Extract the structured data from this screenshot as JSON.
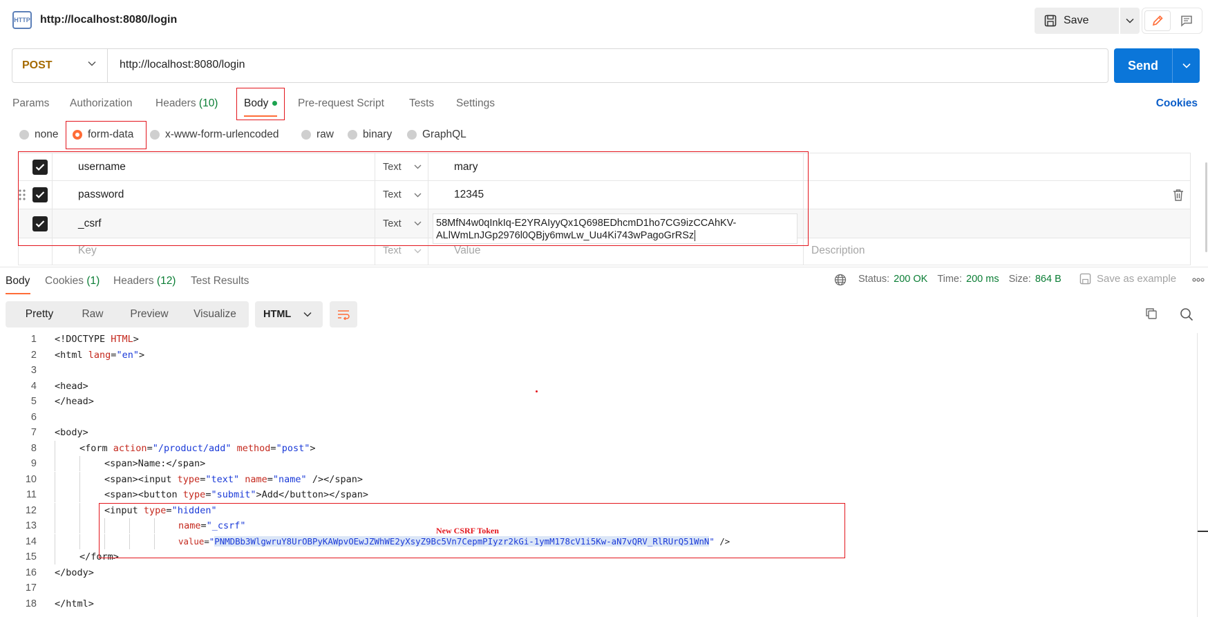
{
  "header": {
    "icon_label": "HTTP",
    "tab_title": "http://localhost:8080/login",
    "save_label": "Save"
  },
  "request": {
    "method": "POST",
    "url": "http://localhost:8080/login",
    "send_label": "Send"
  },
  "request_tabs": [
    {
      "label": "Params",
      "count": ""
    },
    {
      "label": "Authorization",
      "count": ""
    },
    {
      "label": "Headers",
      "count": "(10)"
    },
    {
      "label": "Body",
      "count": ""
    },
    {
      "label": "Pre-request Script",
      "count": ""
    },
    {
      "label": "Tests",
      "count": ""
    },
    {
      "label": "Settings",
      "count": ""
    }
  ],
  "cookies_link": "Cookies",
  "body_types": [
    "none",
    "form-data",
    "x-www-form-urlencoded",
    "raw",
    "binary",
    "GraphQL"
  ],
  "selected_body_type": "form-data",
  "form_rows": [
    {
      "key": "username",
      "type": "Text",
      "value": "mary",
      "checked": true
    },
    {
      "key": "password",
      "type": "Text",
      "value": "12345",
      "checked": true
    },
    {
      "key": "_csrf",
      "type": "Text",
      "value": "58MfN4w0qInkIq-E2YRAIyyQx1Q698EDhcmD1ho7CG9izCCAhKV-ALlWmLnJGp2976l0QBjy6mwLw_Uu4Ki743wPagoGrRSz",
      "value_line1": "58MfN4w0qInkIq-E2YRAIyyQx1Q698EDhcmD1ho7CG9izCCAhKV-",
      "value_line2": "ALlWmLnJGp2976l0QBjy6mwLw_Uu4Ki743wPagoGrRSz",
      "checked": true
    }
  ],
  "form_placeholders": {
    "key": "Key",
    "type": "Text",
    "value": "Value",
    "description": "Description"
  },
  "response_tabs": [
    {
      "label": "Body",
      "count": ""
    },
    {
      "label": "Cookies",
      "count": "(1)"
    },
    {
      "label": "Headers",
      "count": "(12)"
    },
    {
      "label": "Test Results",
      "count": ""
    }
  ],
  "response_status": {
    "status_label": "Status:",
    "status_value": "200 OK",
    "time_label": "Time:",
    "time_value": "200 ms",
    "size_label": "Size:",
    "size_value": "864 B",
    "save_example": "Save as example"
  },
  "view_modes": [
    "Pretty",
    "Raw",
    "Preview",
    "Visualize"
  ],
  "selected_view": "Pretty",
  "language": "HTML",
  "annotation_label": "New CSRF Token",
  "code_lines": [
    {
      "n": "1"
    },
    {
      "n": "2"
    },
    {
      "n": "3"
    },
    {
      "n": "4"
    },
    {
      "n": "5"
    },
    {
      "n": "6"
    },
    {
      "n": "7"
    },
    {
      "n": "8"
    },
    {
      "n": "9"
    },
    {
      "n": "10"
    },
    {
      "n": "11"
    },
    {
      "n": "12"
    },
    {
      "n": "13"
    },
    {
      "n": "14"
    },
    {
      "n": "15"
    },
    {
      "n": "16"
    },
    {
      "n": "17"
    },
    {
      "n": "18"
    }
  ],
  "code": {
    "l1_a": "<!DOCTYPE ",
    "l1_b": "HTML",
    "l1_c": ">",
    "l2_a": "<html ",
    "l2_b": "lang",
    "l2_c": "=",
    "l2_d": "\"en\"",
    "l2_e": ">",
    "l4": "<head>",
    "l5": "</head>",
    "l7": "<body>",
    "l8_a": "<form ",
    "l8_b": "action",
    "l8_c": "=",
    "l8_d": "\"/product/add\"",
    "l8_e": " ",
    "l8_f": "method",
    "l8_g": "=",
    "l8_h": "\"post\"",
    "l8_i": ">",
    "l9": "<span>Name:</span>",
    "l10_a": "<span><input ",
    "l10_b": "type",
    "l10_c": "=",
    "l10_d": "\"text\"",
    "l10_e": " ",
    "l10_f": "name",
    "l10_g": "=",
    "l10_h": "\"name\"",
    "l10_i": " /></span>",
    "l11_a": "<span><button ",
    "l11_b": "type",
    "l11_c": "=",
    "l11_d": "\"submit\"",
    "l11_e": ">Add</button></span>",
    "l12_a": "<input ",
    "l12_b": "type",
    "l12_c": "=",
    "l12_d": "\"hidden\"",
    "l13_a": "name",
    "l13_b": "=",
    "l13_c": "\"_csrf\"",
    "l14_a": "value",
    "l14_b": "=",
    "l14_c": "\"",
    "l14_d": "PNMDBb3WlgwruY8UrOBPyKAWpvOEwJZWhWE2yXsyZ9Bc5Vn7CepmPIyzr2kGi-1ymM178cV1i5Kw-aN7vQRV_RlRUrQ51WnN",
    "l14_e": "\"",
    "l14_f": " />",
    "l15": "</form>",
    "l16": "</body>",
    "l18": "</html>"
  }
}
